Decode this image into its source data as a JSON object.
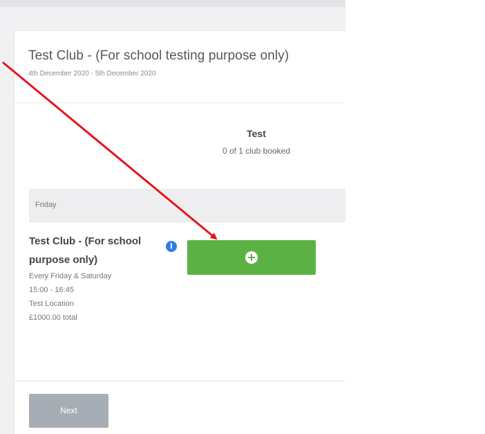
{
  "club": {
    "title": "Test Club - (For school testing purpose only)",
    "dates": "4th December 2020 - 5th December 2020"
  },
  "column": {
    "title": "Test",
    "booked": "0 of 1 club booked"
  },
  "day": {
    "label": "Friday"
  },
  "session": {
    "title": "Test Club - (For school purpose only)",
    "schedule": "Every Friday & Saturday",
    "time": "15:00 - 16:45",
    "location": "Test Location",
    "price": "£1000.00 total"
  },
  "info_icon": {
    "glyph": "i",
    "color": "#2b7de9"
  },
  "add_button": {
    "icon": "plus-circle-icon",
    "color": "#5cb145"
  },
  "next_button": {
    "label": "Next",
    "color": "#a7adb4"
  },
  "annotation": {
    "color": "#e8141b"
  }
}
